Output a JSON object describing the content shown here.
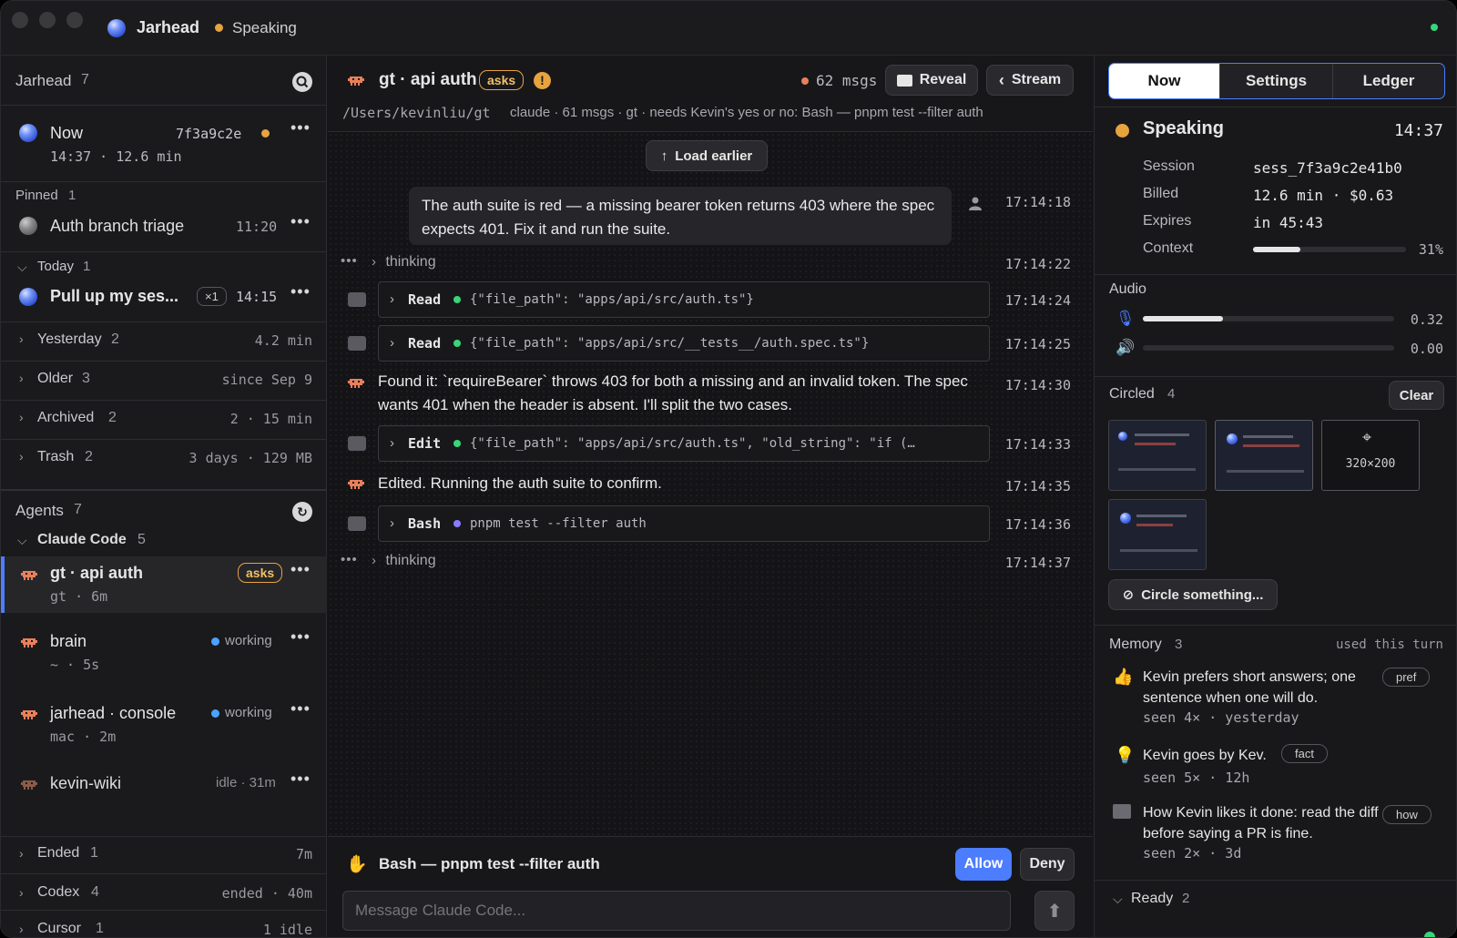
{
  "titlebar": {
    "app_name": "Jarhead",
    "status": "Speaking"
  },
  "sidebar": {
    "header": {
      "title": "Jarhead",
      "count": "7"
    },
    "now": {
      "title": "Now",
      "hash": "7f3a9c2e",
      "meta": "14:37 · 12.6 min"
    },
    "pinned": {
      "label": "Pinned",
      "count": "1",
      "item": {
        "title": "Auth branch triage",
        "time": "11:20"
      }
    },
    "today": {
      "label": "Today",
      "count": "1",
      "item": {
        "title": "Pull up my ses...",
        "badge": "×1",
        "time": "14:15"
      }
    },
    "groups": [
      {
        "label": "Yesterday",
        "count": "2",
        "meta": "4.2 min"
      },
      {
        "label": "Older",
        "count": "3",
        "meta": "since Sep 9"
      },
      {
        "label": "Archived",
        "count": "2",
        "meta": "2 · 15 min"
      },
      {
        "label": "Trash",
        "count": "2",
        "meta": "3 days · 129 MB"
      }
    ],
    "agents": {
      "label": "Agents",
      "count": "7"
    },
    "claude": {
      "label": "Claude Code",
      "count": "5"
    },
    "agent_items": [
      {
        "title": "gt · api auth",
        "badge": "asks",
        "meta": "gt · 6m"
      },
      {
        "title": "brain",
        "status": "working",
        "meta": "~ · 5s"
      },
      {
        "title": "jarhead · console",
        "status": "working",
        "meta": "mac · 2m"
      },
      {
        "title": "kevin-wiki",
        "status": "idle · 31m"
      }
    ],
    "bottom_groups": [
      {
        "label": "Ended",
        "count": "1",
        "meta": "7m"
      },
      {
        "label": "Codex",
        "count": "4",
        "meta": "ended · 40m"
      },
      {
        "label": "Cursor",
        "count": "1",
        "meta": "1 idle"
      }
    ]
  },
  "main": {
    "header": {
      "title": "gt · api auth",
      "badge": "asks",
      "msgs": "62 msgs",
      "reveal_label": "Reveal",
      "stream_label": "Stream",
      "path": "/Users/kevinliu/gt",
      "subtitle": "claude · 61 msgs · gt · needs Kevin's yes or no: Bash — pnpm test --filter auth"
    },
    "load_earlier": "Load earlier",
    "user_message": {
      "text": "The auth suite is red — a missing bearer token returns 403 where the spec expects 401. Fix it and run the suite.",
      "time": "17:14:18"
    },
    "thinking1": {
      "label": "thinking",
      "time": "17:14:22"
    },
    "read1": {
      "tool": "Read",
      "args": "{\"file_path\": \"apps/api/src/auth.ts\"}",
      "time": "17:14:24"
    },
    "read2": {
      "tool": "Read",
      "args": "{\"file_path\": \"apps/api/src/__tests__/auth.spec.ts\"}",
      "time": "17:14:25"
    },
    "found": {
      "text": "Found it: `requireBearer` throws 403 for both a missing and an invalid token. The spec wants 401 when the header is absent. I'll split the two cases.",
      "time": "17:14:30"
    },
    "edit": {
      "tool": "Edit",
      "args": "{\"file_path\": \"apps/api/src/auth.ts\", \"old_string\": \"if (…",
      "time": "17:14:33"
    },
    "edited": {
      "text": "Edited. Running the auth suite to confirm.",
      "time": "17:14:35"
    },
    "bash": {
      "tool": "Bash",
      "args": "pnpm test --filter auth",
      "time": "17:14:36"
    },
    "thinking2": {
      "label": "thinking",
      "time": "17:14:37"
    },
    "permission": {
      "text": "Bash — pnpm test --filter auth",
      "allow": "Allow",
      "deny": "Deny"
    },
    "composer": {
      "placeholder": "Message Claude Code..."
    }
  },
  "right": {
    "tabs": [
      "Now",
      "Settings",
      "Ledger"
    ],
    "speaking": {
      "title": "Speaking",
      "time": "14:37"
    },
    "session": [
      {
        "key": "Session",
        "value": "sess_7f3a9c2e41b0"
      },
      {
        "key": "Billed",
        "value": "12.6 min · $0.63"
      },
      {
        "key": "Expires",
        "value": "in 45:43"
      }
    ],
    "context": {
      "key": "Context",
      "percent_label": "31%",
      "fraction": 0.31
    },
    "audio": {
      "label": "Audio",
      "mic_value": "0.32",
      "mic_level": 0.32,
      "speaker_value": "0.00",
      "speaker_level": 0.0
    },
    "circled": {
      "label": "Circled",
      "count": "4",
      "clear": "Clear",
      "placeholder_size": "320×200",
      "circle_button": "Circle something..."
    },
    "memory": {
      "label": "Memory",
      "count": "3",
      "note": "used this turn",
      "items": [
        {
          "text": "Kevin prefers short answers; one sentence when one will do.",
          "tag": "pref",
          "seen": "seen 4× · yesterday"
        },
        {
          "text": "Kevin goes by Kev.",
          "tag": "fact",
          "seen": "seen 5× · 12h"
        },
        {
          "text": "How Kevin likes it done: read the diff before saying a PR is fine.",
          "tag": "how",
          "seen": "seen 2× · 3d"
        }
      ]
    },
    "ready": {
      "label": "Ready",
      "count": "2"
    }
  },
  "colors": {
    "accent": "#4c7dff",
    "warning": "#e7a33e",
    "working": "#4aa3ff",
    "ok": "#37d67a"
  }
}
